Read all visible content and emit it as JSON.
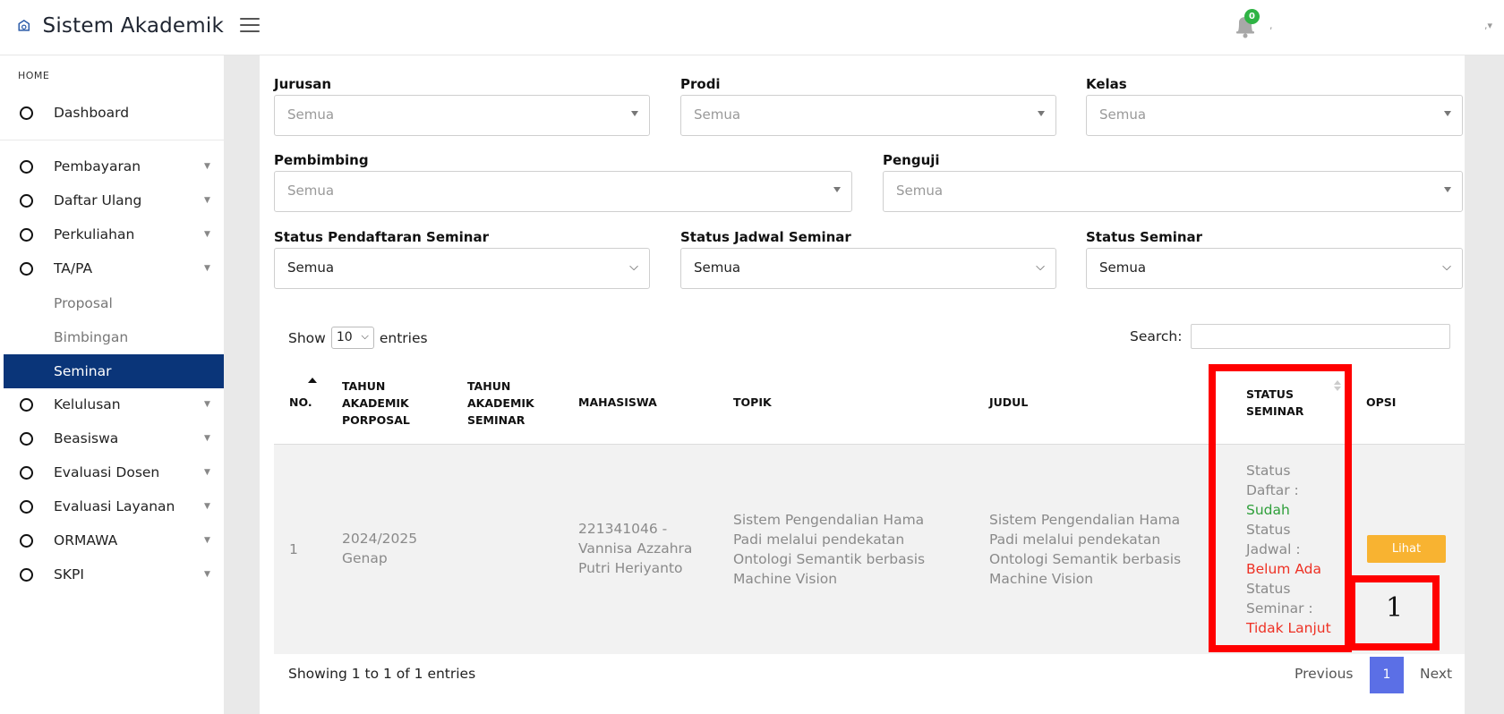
{
  "header": {
    "app_title": "Sistem Akademik",
    "notification_count": "0",
    "menu_icon": "hamburger-icon",
    "bell_icon": "bell-icon"
  },
  "sidebar": {
    "section_header": "HOME",
    "items": [
      {
        "label": "Dashboard"
      },
      {
        "label": "Pembayaran"
      },
      {
        "label": "Daftar Ulang"
      },
      {
        "label": "Perkuliahan"
      },
      {
        "label": "TA/PA"
      },
      {
        "label": "Kelulusan"
      },
      {
        "label": "Beasiswa"
      },
      {
        "label": "Evaluasi Dosen"
      },
      {
        "label": "Evaluasi Layanan"
      },
      {
        "label": "ORMAWA"
      },
      {
        "label": "SKPI"
      }
    ],
    "subitems": [
      {
        "label": "Proposal"
      },
      {
        "label": "Bimbingan"
      },
      {
        "label": "Seminar",
        "active": true
      }
    ],
    "active_color": "#0a3579"
  },
  "filters": {
    "jurusan": {
      "label": "Jurusan",
      "value": "Semua"
    },
    "prodi": {
      "label": "Prodi",
      "value": "Semua"
    },
    "kelas": {
      "label": "Kelas",
      "value": "Semua"
    },
    "pembimbing": {
      "label": "Pembimbing",
      "value": "Semua"
    },
    "penguji": {
      "label": "Penguji",
      "value": "Semua"
    },
    "status_pendaftaran": {
      "label": "Status Pendaftaran Seminar",
      "value": "Semua"
    },
    "status_jadwal": {
      "label": "Status Jadwal Seminar",
      "value": "Semua"
    },
    "status_seminar": {
      "label": "Status Seminar",
      "value": "Semua"
    }
  },
  "table_controls": {
    "show_label": "Show",
    "entries_value": "10",
    "entries_label": "entries",
    "search_label": "Search:"
  },
  "table": {
    "headers": {
      "no": "NO.",
      "tahun_proposal": [
        "TAHUN",
        "AKADEMIK",
        "PORPOSAL"
      ],
      "tahun_seminar": [
        "TAHUN",
        "AKADEMIK",
        "SEMINAR"
      ],
      "mahasiswa": "MAHASISWA",
      "topik": "TOPIK",
      "judul": "JUDUL",
      "status": [
        "STATUS",
        "SEMINAR"
      ],
      "opsi": "OPSI"
    },
    "rows": [
      {
        "no": "1",
        "tahun_proposal": [
          "2024/2025",
          "Genap"
        ],
        "tahun_seminar": "",
        "mahasiswa": [
          "221341046 -",
          "Vannisa Azzahra",
          "Putri Heriyanto"
        ],
        "topik": [
          "Sistem Pengendalian Hama",
          "Padi melalui pendekatan",
          "Ontologi Semantik berbasis",
          "Machine Vision"
        ],
        "judul": [
          "Sistem Pengendalian Hama",
          "Padi melalui pendekatan",
          "Ontologi Semantik berbasis",
          "Machine Vision"
        ],
        "status_lines": {
          "daftar_label": [
            "Status",
            "Daftar :"
          ],
          "daftar_value": "Sudah",
          "jadwal_label": [
            "Status",
            "Jadwal :"
          ],
          "jadwal_value": "Belum Ada",
          "seminar_label": [
            "Status",
            "Seminar :"
          ],
          "seminar_value": "Tidak Lanjut"
        },
        "action_label": "Lihat"
      }
    ]
  },
  "footer": {
    "showing_text": "Showing 1 to 1 of 1 entries",
    "prev_label": "Previous",
    "page": "1",
    "next_label": "Next"
  },
  "annotation": {
    "label": "1",
    "color": "#ff0000"
  }
}
